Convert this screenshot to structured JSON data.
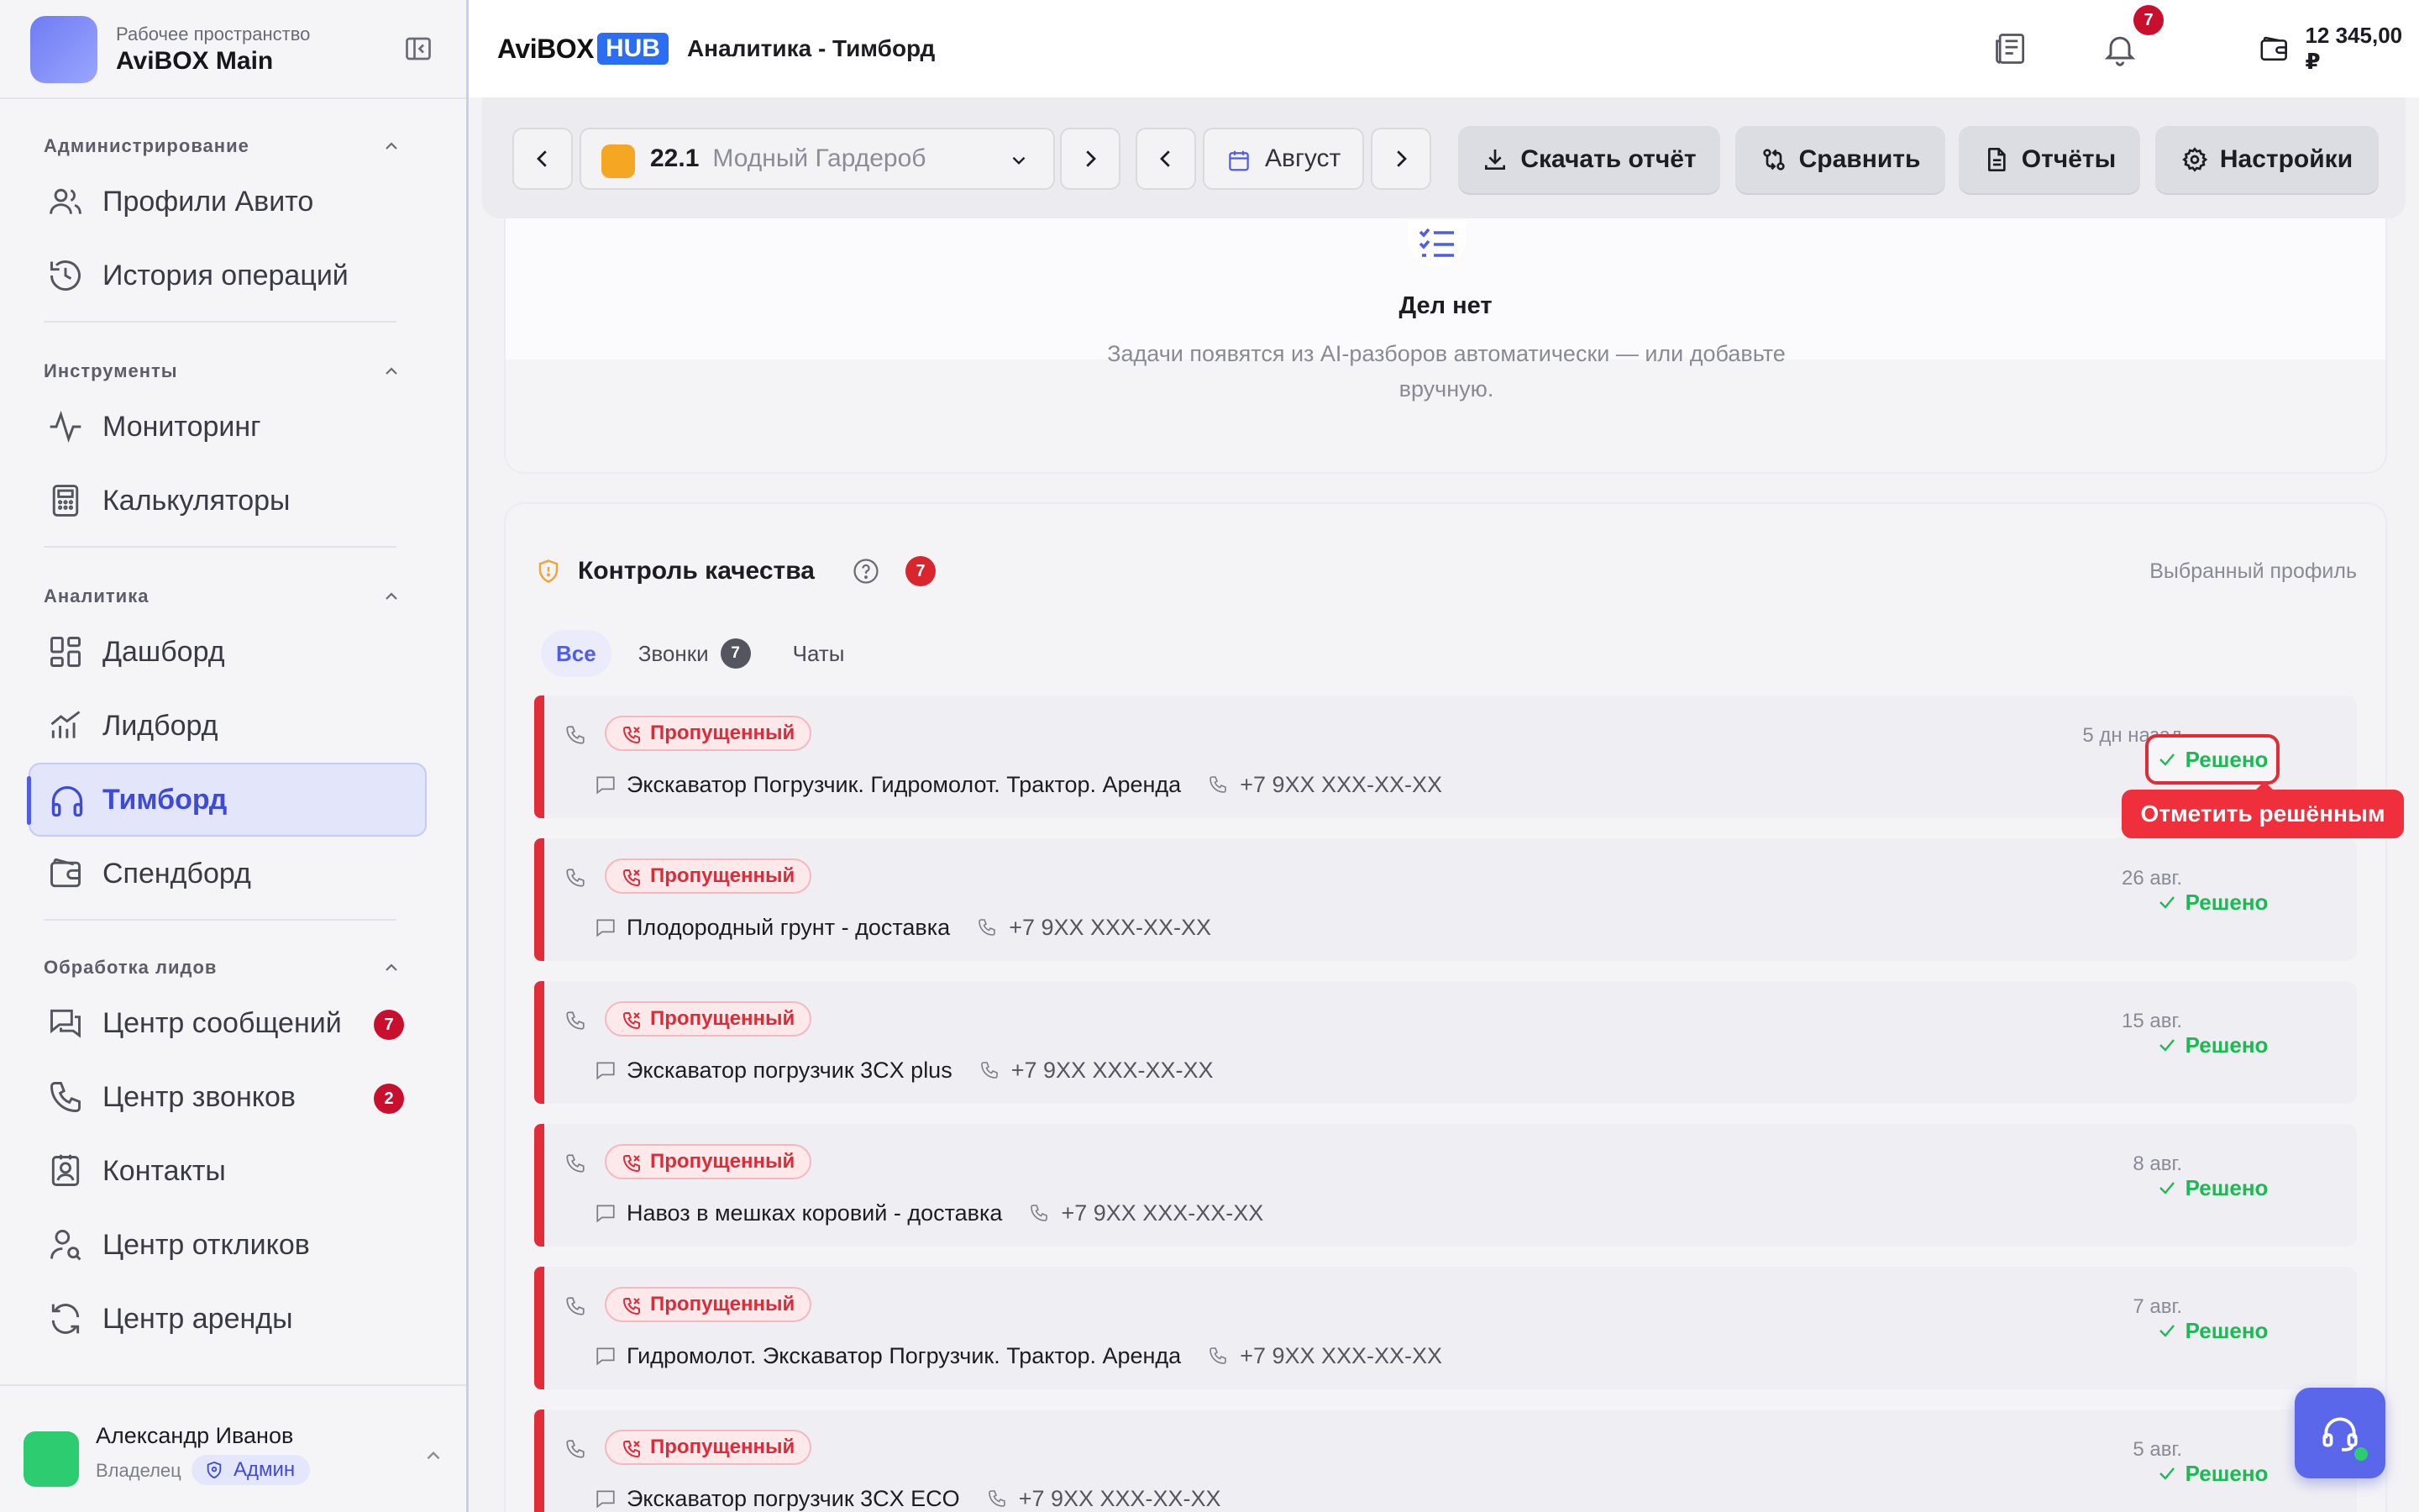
{
  "workspace": {
    "subtitle": "Рабочее пространство",
    "title": "AviBOX Main"
  },
  "sidebar": {
    "sections": [
      {
        "title": "Администрирование",
        "items": [
          {
            "label": "Профили Авито",
            "icon": "users-icon"
          },
          {
            "label": "История операций",
            "icon": "history-icon"
          }
        ]
      },
      {
        "title": "Инструменты",
        "items": [
          {
            "label": "Мониторинг",
            "icon": "activity-icon"
          },
          {
            "label": "Калькуляторы",
            "icon": "calculator-icon"
          }
        ]
      },
      {
        "title": "Аналитика",
        "items": [
          {
            "label": "Дашборд",
            "icon": "dashboard-icon"
          },
          {
            "label": "Лидборд",
            "icon": "chart-icon"
          },
          {
            "label": "Тимборд",
            "icon": "headphones-icon",
            "active": true
          },
          {
            "label": "Спендборд",
            "icon": "wallet-icon"
          }
        ]
      },
      {
        "title": "Обработка лидов",
        "items": [
          {
            "label": "Центр сообщений",
            "icon": "messages-icon",
            "badge": "7"
          },
          {
            "label": "Центр звонков",
            "icon": "phone-icon",
            "badge": "2"
          },
          {
            "label": "Контакты",
            "icon": "contacts-icon"
          },
          {
            "label": "Центр откликов",
            "icon": "user-search-icon"
          },
          {
            "label": "Центр аренды",
            "icon": "refresh-icon"
          }
        ]
      }
    ]
  },
  "user": {
    "name": "Александр Иванов",
    "role": "Владелец",
    "badge": "Админ"
  },
  "topbar": {
    "brand_main": "AviBOX",
    "brand_hub": "HUB",
    "page_title": "Аналитика - Тимборд",
    "notifications_count": "7",
    "balance": "12 345,00 ₽"
  },
  "toolbar": {
    "profile_number": "22.1",
    "profile_name": "Модный Гардероб",
    "month": "Август",
    "download_label": "Скачать отчёт",
    "compare_label": "Сравнить",
    "reports_label": "Отчёты",
    "settings_label": "Настройки"
  },
  "tasks": {
    "title": "Дел нет",
    "description": "Задачи появятся из AI-разборов автоматически — или добавьте вручную."
  },
  "quality": {
    "title": "Контроль качества",
    "badge": "7",
    "profile_label": "Выбранный профиль",
    "tabs": [
      {
        "label": "Все",
        "active": true
      },
      {
        "label": "Звонки",
        "count": "7"
      },
      {
        "label": "Чаты"
      }
    ],
    "rows": [
      {
        "status": "Пропущенный",
        "title": "Экскаватор Погрузчик. Гидромолот. Трактор. Аренда",
        "phone": "+7 9XX XXX-XX-XX",
        "date": "5 дн назад",
        "action": "Решено",
        "highlight": true
      },
      {
        "status": "Пропущенный",
        "title": "Плодородный грунт - доставка",
        "phone": "+7 9XX XXX-XX-XX",
        "date": "26 авг.",
        "action": "Решено"
      },
      {
        "status": "Пропущенный",
        "title": "Экскаватор погрузчик 3CX plus",
        "phone": "+7 9XX XXX-XX-XX",
        "date": "15 авг.",
        "action": "Решено"
      },
      {
        "status": "Пропущенный",
        "title": "Навоз в мешках коровий - доставка",
        "phone": "+7 9XX XXX-XX-XX",
        "date": "8 авг.",
        "action": "Решено"
      },
      {
        "status": "Пропущенный",
        "title": "Гидромолот. Экскаватор Погрузчик. Трактор. Аренда",
        "phone": "+7 9XX XXX-XX-XX",
        "date": "7 авг.",
        "action": "Решено"
      },
      {
        "status": "Пропущенный",
        "title": "Экскаватор погрузчик 3CX ECO",
        "phone": "+7 9XX XXX-XX-XX",
        "date": "5 авг.",
        "action": "Решено"
      }
    ],
    "tooltip": "Отметить решённым"
  },
  "colors": {
    "accent": "#4f5ce8",
    "danger": "#e12c3a",
    "success": "#1db954",
    "brand_hub": "#2a6ef5"
  }
}
